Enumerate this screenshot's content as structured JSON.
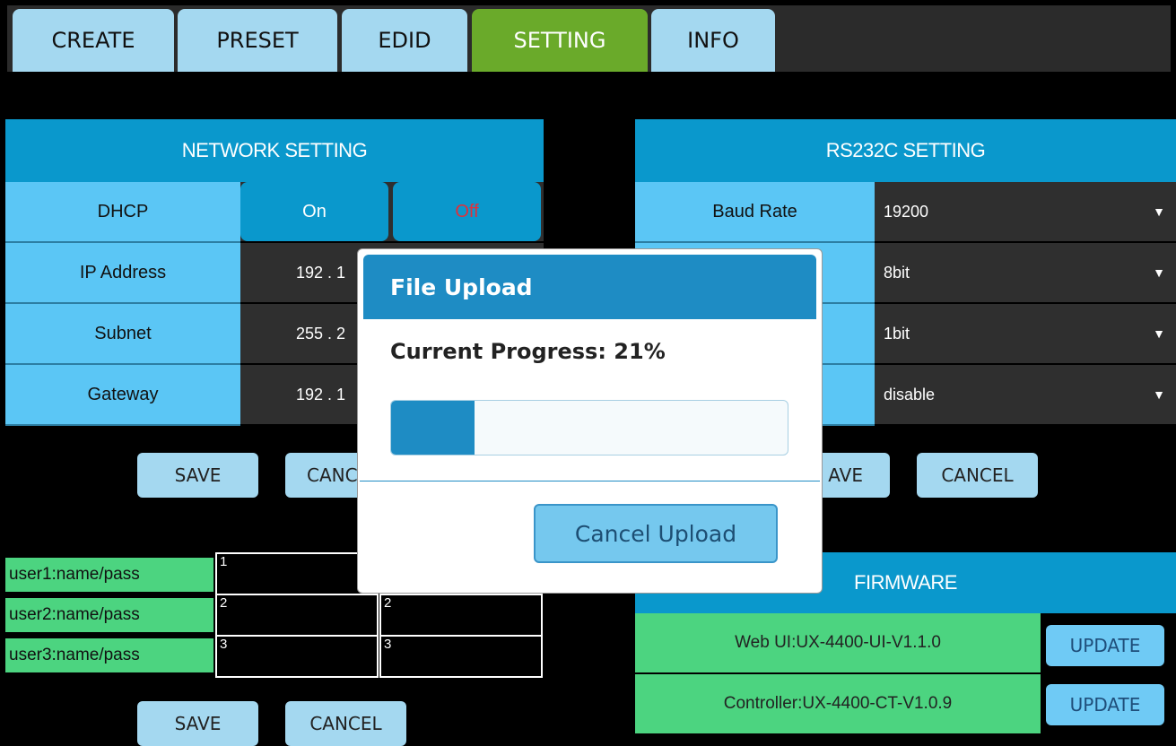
{
  "tabs": [
    {
      "label": "CREATE",
      "active": false
    },
    {
      "label": "PRESET",
      "active": false
    },
    {
      "label": "EDID",
      "active": false
    },
    {
      "label": "SETTING",
      "active": true
    },
    {
      "label": "INFO",
      "active": false
    }
  ],
  "network": {
    "title": "NETWORK SETTING",
    "dhcp": {
      "label": "DHCP",
      "on": "On",
      "off": "Off"
    },
    "rows": [
      {
        "label": "IP Address",
        "value": "192 . 1"
      },
      {
        "label": "Subnet",
        "value": "255 . 2"
      },
      {
        "label": "Gateway",
        "value": "192 . 1"
      }
    ],
    "save": "SAVE",
    "cancel": "CANC"
  },
  "rs232": {
    "title": "RS232C SETTING",
    "baud_label": "Baud Rate",
    "rows": [
      {
        "value": "19200"
      },
      {
        "value": "8bit"
      },
      {
        "value": "1bit"
      },
      {
        "value": "disable"
      }
    ],
    "save": "AVE",
    "cancel": "CANCEL"
  },
  "users": [
    {
      "label": "user1:name/pass",
      "name": "1",
      "pass": ""
    },
    {
      "label": "user2:name/pass",
      "name": "2",
      "pass": "2"
    },
    {
      "label": "user3:name/pass",
      "name": "3",
      "pass": "3"
    }
  ],
  "users_save": "SAVE",
  "users_cancel": "CANCEL",
  "firmware": {
    "title": "FIRMWARE",
    "rows": [
      {
        "name": "Web UI:UX-4400-UI-V1.1.0",
        "button": "UPDATE"
      },
      {
        "name": "Controller:UX-4400-CT-V1.0.9",
        "button": "UPDATE"
      }
    ]
  },
  "modal": {
    "title": "File Upload",
    "progress_text": "Current Progress: 21%",
    "progress": 0.21,
    "cancel": "Cancel Upload"
  },
  "colors": {
    "accent": "#0a98cc",
    "active_tab": "#6aaa2a",
    "green": "#4cd480",
    "off_red": "#e0303a"
  }
}
